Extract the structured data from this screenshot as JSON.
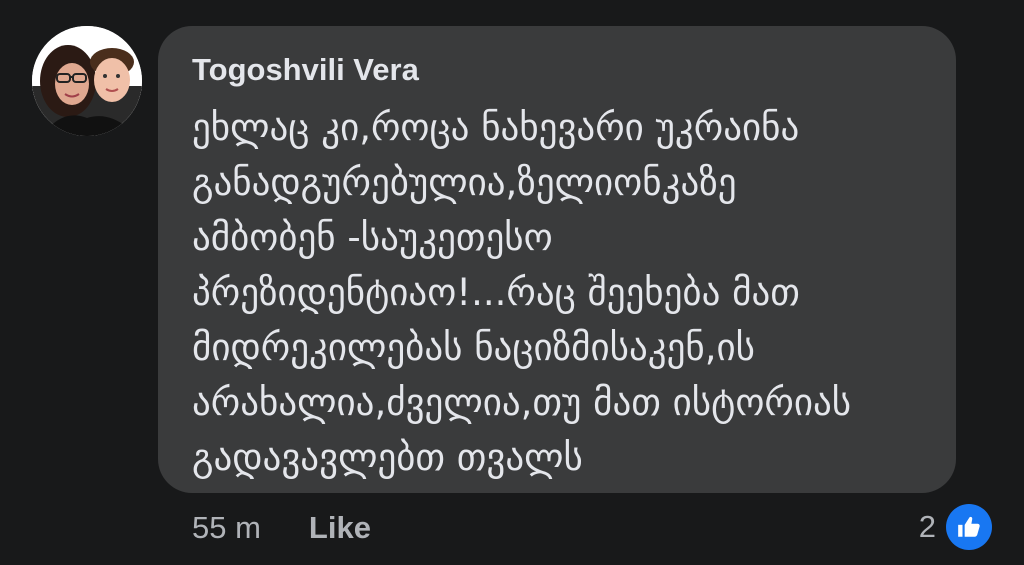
{
  "comment": {
    "author": "Togoshvili Vera",
    "lines": [
      "ეხლაც კი,როცა ნახევარი უკრაინა",
      "განადგურებულია,ზელიონკაზე",
      "ამბობენ -საუკეთესო",
      "პრეზიდენტიაო!...რაც შეეხება მათ",
      "მიდრეკილებას ნაციზმისაკენ,ის",
      "არახალია,ძველია,თუ მათ ისტორიას",
      "გადავავლებთ თვალს"
    ]
  },
  "actions": {
    "time": "55 m",
    "like_label": "Like"
  },
  "reactions": {
    "count": "2",
    "icon": "thumbs-up-icon",
    "accent": "#1877f2"
  },
  "colors": {
    "background": "#18191a",
    "bubble": "#3a3b3c",
    "text": "#e4e6eb",
    "secondary": "#b0b3b8"
  }
}
